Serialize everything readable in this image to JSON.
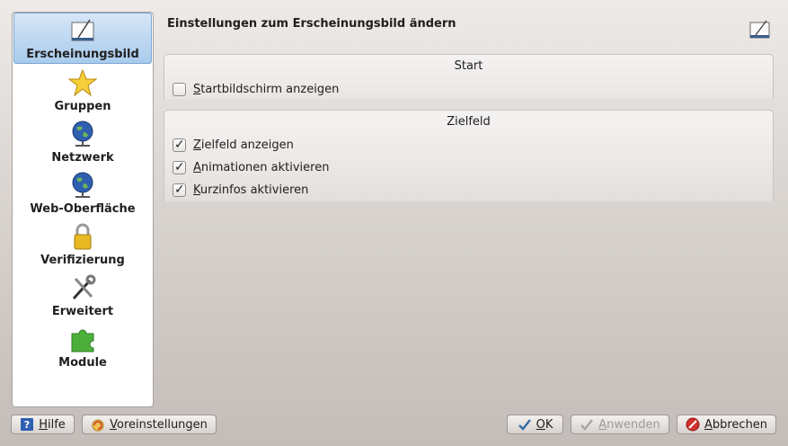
{
  "header": {
    "title": "Einstellungen zum Erscheinungsbild ändern",
    "icon": "appearance-icon"
  },
  "sidebar": {
    "items": [
      {
        "label": "Erscheinungsbild",
        "icon": "appearance-icon",
        "selected": true
      },
      {
        "label": "Gruppen",
        "icon": "star-icon",
        "selected": false
      },
      {
        "label": "Netzwerk",
        "icon": "globe-network-icon",
        "selected": false
      },
      {
        "label": "Web-Oberfläche",
        "icon": "globe-network-icon",
        "selected": false
      },
      {
        "label": "Verifizierung",
        "icon": "padlock-icon",
        "selected": false
      },
      {
        "label": "Erweitert",
        "icon": "tools-icon",
        "selected": false
      },
      {
        "label": "Module",
        "icon": "puzzle-icon",
        "selected": false
      }
    ]
  },
  "groups": {
    "start": {
      "title": "Start",
      "options": [
        {
          "access_key": "S",
          "rest": "tartbildschirm anzeigen",
          "checked": false
        }
      ]
    },
    "zielfeld": {
      "title": "Zielfeld",
      "options": [
        {
          "access_key": "Z",
          "rest": "ielfeld anzeigen",
          "checked": true
        },
        {
          "access_key": "A",
          "rest": "nimationen aktivieren",
          "checked": true
        },
        {
          "access_key": "K",
          "rest": "urzinfos aktivieren",
          "checked": true
        }
      ]
    }
  },
  "buttons": {
    "help": {
      "access_key": "H",
      "rest": "ilfe",
      "icon": "help-icon"
    },
    "defaults": {
      "access_key": "V",
      "rest": "oreinstellungen",
      "icon": "reset-icon"
    },
    "ok": {
      "access_key": "O",
      "rest": "K",
      "icon": "checkmark-icon"
    },
    "apply": {
      "access_key": "A",
      "rest": "nwenden",
      "icon": "checkmark-icon",
      "enabled": false
    },
    "cancel": {
      "access_key": "A",
      "rest": "bbrechen",
      "icon": "cancel-icon"
    }
  },
  "colors": {
    "selection": "#a9cbec",
    "cancel_red": "#d0312d",
    "checkmark_blue": "#3a6ea5"
  }
}
